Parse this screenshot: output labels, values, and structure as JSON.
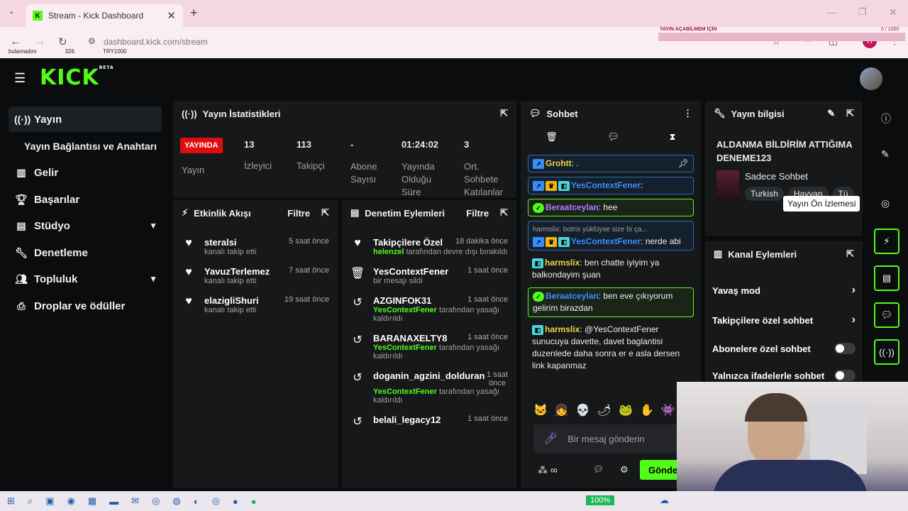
{
  "browser": {
    "tab_title": "Stream - Kick Dashboard",
    "url": "dashboard.kick.com/stream",
    "ticker": [
      "bulamadım",
      "326",
      "TRY1000"
    ],
    "overlay_label": "YAYIN AÇABİLMEM İÇİN",
    "overlay_count": "0 / 1000"
  },
  "header": {
    "logo": "KICK",
    "logo_badge": "BETA"
  },
  "sidebar": {
    "items": [
      {
        "label": "Yayın",
        "icon": "broadcast-icon"
      },
      {
        "label": "Yayın Bağlantısı ve Anahtarı",
        "icon": ""
      },
      {
        "label": "Gelir",
        "icon": "bar-chart-icon"
      },
      {
        "label": "Başarılar",
        "icon": "trophy-icon"
      },
      {
        "label": "Stüdyo",
        "icon": "studio-icon"
      },
      {
        "label": "Denetleme",
        "icon": "wrench-icon"
      },
      {
        "label": "Topluluk",
        "icon": "community-icon"
      },
      {
        "label": "Droplar ve ödüller",
        "icon": "gift-icon"
      }
    ]
  },
  "stats": {
    "title": "Yayın İstatistikleri",
    "live_badge": "YAYINDA",
    "columns": [
      {
        "value": "13",
        "label": "İzleyici"
      },
      {
        "value": "113",
        "label": "Takipçi"
      },
      {
        "value": "-",
        "label": "Abone Sayısı"
      },
      {
        "value": "01:24:02",
        "label": "Yayında Olduğu Süre"
      },
      {
        "value": "3",
        "label": "Ort. Sohbete Katılanlar"
      }
    ],
    "first_label": "Yayın"
  },
  "activity": {
    "title": "Etkinlik Akışı",
    "filter": "Filtre",
    "events": [
      {
        "user": "steralsi",
        "desc": "kanalı takip etti",
        "time": "5 saat önce"
      },
      {
        "user": "YavuzTerlemez",
        "desc": "kanalı takip etti",
        "time": "7 saat önce"
      },
      {
        "user": "elazigliShuri",
        "desc": "kanalı takip etti",
        "time": "19 saat önce"
      }
    ]
  },
  "moderation": {
    "title": "Denetim Eylemleri",
    "filter": "Filtre",
    "events": [
      {
        "title": "Takipçilere Özel",
        "time": "18 dakika önce",
        "actor": "helenzel",
        "desc": "tarafından devre dışı bırakıldı"
      },
      {
        "title": "YesContextFener",
        "time": "1 saat önce",
        "actor": "",
        "desc": "bir mesajı sildi"
      },
      {
        "title": "AZGINFOK31",
        "time": "1 saat önce",
        "actor": "YesContextFener",
        "desc": "tarafından yasağı kaldırıldı"
      },
      {
        "title": "BARANAXELTY8",
        "time": "1 saat önce",
        "actor": "YesContextFener",
        "desc": "tarafından yasağı kaldırıldı"
      },
      {
        "title": "doganin_agzini_dolduran",
        "time": "1 saat önce",
        "actor": "YesContextFener",
        "desc": "tarafından yasağı kaldırıldı"
      },
      {
        "title": "belali_legacy12",
        "time": "1 saat önce",
        "actor": "",
        "desc": ""
      }
    ]
  },
  "chat": {
    "title": "Sohbet",
    "messages": [
      {
        "user": "Grohtt",
        "text": ": .",
        "style": "hlb",
        "ucolor": "u-yellow"
      },
      {
        "user": "YesContextFener",
        "text": ":",
        "style": "hlb",
        "ucolor": "u-blue"
      },
      {
        "user": "Beraatceylan",
        "text": ": hee",
        "style": "hl",
        "ucolor": "u-purple"
      },
      {
        "reply": "harmslix: botrix yüklüyse size bi ça...",
        "user": "YesContextFener",
        "text": ": nerde abi",
        "style": "hlb",
        "ucolor": "u-blue"
      },
      {
        "user": "harmslix",
        "text": ": ben chatte iyiyim ya balkondayim şuan",
        "style": "",
        "ucolor": "u-yellow"
      },
      {
        "user": "Beraatceylan",
        "text": ": ben eve çıkıyorum gelirim birazdan",
        "style": "hl",
        "ucolor": "u-blue"
      },
      {
        "user": "harmslix",
        "text": ": @YesContextFener sunucuya davette, davet baglantisi duzenlede daha sonra er e asla dersen link kapanmaz",
        "style": "",
        "ucolor": "u-yellow"
      }
    ],
    "placeholder": "Bir mesaj gönderin",
    "send": "Gönder",
    "points": "∞"
  },
  "info": {
    "title": "Yayın bilgisi",
    "stream_title": "ALDANMA BİLDİRİM ATTIĞIMA DENEME123",
    "category": "Sadece Sohbet",
    "tags": [
      "Turkish",
      "Hayvan",
      "Tü"
    ],
    "tooltip": "Yayın Ön İzlemesi"
  },
  "actions": {
    "title": "Kanal Eylemleri",
    "rows": [
      {
        "label": "Yavaş mod",
        "kind": "chevron"
      },
      {
        "label": "Takipçilere özel sohbet",
        "kind": "chevron"
      },
      {
        "label": "Abonelere özel sohbet",
        "kind": "toggle"
      },
      {
        "label": "Yalnızca ifadelerle sohbet",
        "kind": "toggle"
      }
    ]
  },
  "taskbar": {
    "battery": "100%"
  },
  "colors": {
    "accent": "#53fc18",
    "live": "#e00d0d",
    "panel": "#16181a"
  }
}
